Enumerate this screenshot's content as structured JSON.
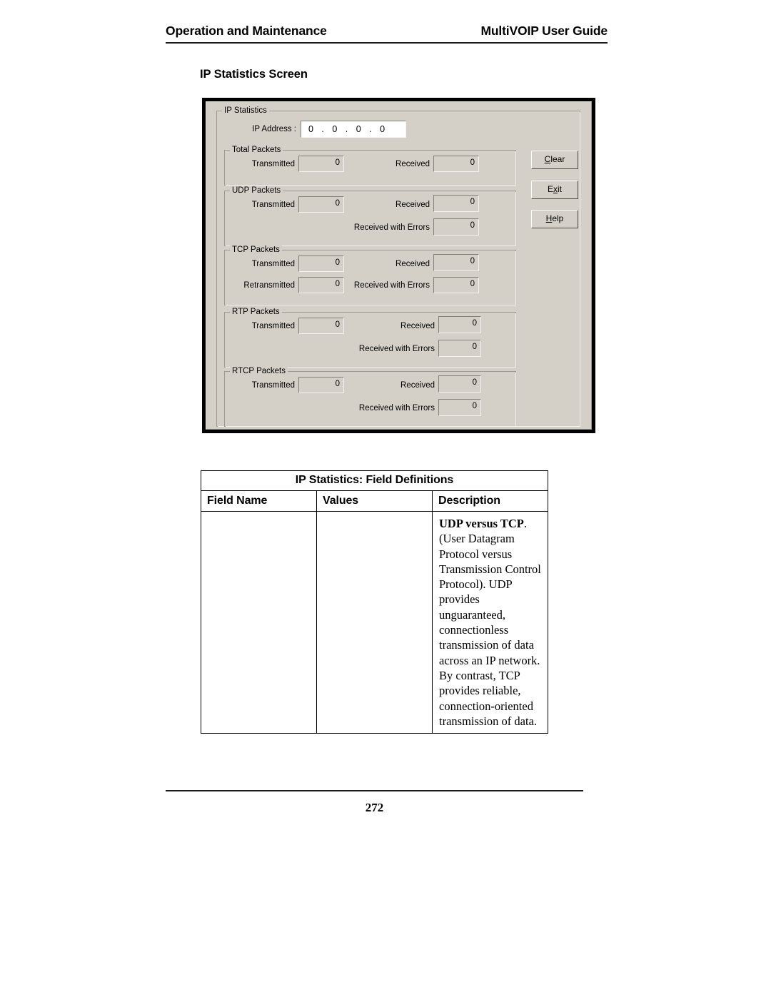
{
  "page": {
    "header_left": "Operation and Maintenance",
    "header_right": "MultiVOIP User Guide",
    "section_heading": "IP Statistics Screen",
    "page_number": "272"
  },
  "dialog": {
    "group_title": "IP Statistics",
    "ip_address_label": "IP Address :",
    "ip_address_value": "0 . 0 . 0 . 0",
    "buttons": [
      {
        "name": "clear",
        "pre": "C",
        "post": "lear"
      },
      {
        "name": "exit",
        "pre": "E",
        "acc": "x",
        "post": "it"
      },
      {
        "name": "help",
        "pre": "H",
        "post": "elp"
      }
    ],
    "groups": [
      {
        "title": "Total Packets",
        "fields": [
          {
            "label": "Transmitted",
            "value": "0"
          },
          {
            "label": "Received",
            "value": "0"
          }
        ]
      },
      {
        "title": "UDP Packets",
        "fields": [
          {
            "label": "Transmitted",
            "value": "0"
          },
          {
            "label": "Received",
            "value": "0"
          },
          {
            "label": "Received with Errors",
            "value": "0"
          }
        ]
      },
      {
        "title": "TCP Packets",
        "fields": [
          {
            "label": "Transmitted",
            "value": "0"
          },
          {
            "label": "Received",
            "value": "0"
          },
          {
            "label": "Retransmitted",
            "value": "0"
          },
          {
            "label": "Received with Errors",
            "value": "0"
          }
        ]
      },
      {
        "title": "RTP Packets",
        "fields": [
          {
            "label": "Transmitted",
            "value": "0"
          },
          {
            "label": "Received",
            "value": "0"
          },
          {
            "label": "Received with Errors",
            "value": "0"
          }
        ]
      },
      {
        "title": "RTCP Packets",
        "fields": [
          {
            "label": "Transmitted",
            "value": "0"
          },
          {
            "label": "Received",
            "value": "0"
          },
          {
            "label": "Received with Errors",
            "value": "0"
          }
        ]
      }
    ]
  },
  "table": {
    "caption": "IP Statistics: Field Definitions",
    "columns": [
      "Field Name",
      "Values",
      "Description"
    ],
    "rows": [
      {
        "field_name": "",
        "values": "",
        "description_bold": "UDP versus TCP",
        "description_rest": ". (User Datagram Protocol versus Transmission Control Protocol).  UDP provides unguaranteed, connectionless transmission of data across an IP network. By contrast, TCP provides reliable, connection-oriented transmission of data."
      }
    ]
  },
  "colors": {
    "dialog_face": "#d4d0c8",
    "dialog_border": "#000000",
    "text": "#000000"
  }
}
